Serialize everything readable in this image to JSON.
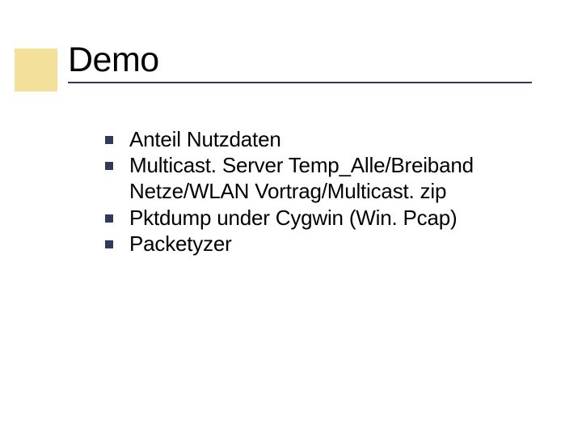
{
  "title": "Demo",
  "bullets": [
    {
      "text": "Anteil Nutzdaten"
    },
    {
      "text": "Multicast. Server Temp_Alle/Breiband Netze/WLAN Vortrag/Multicast. zip"
    },
    {
      "text": "Pktdump under Cygwin (Win. Pcap)"
    },
    {
      "text": "Packetyzer"
    }
  ]
}
